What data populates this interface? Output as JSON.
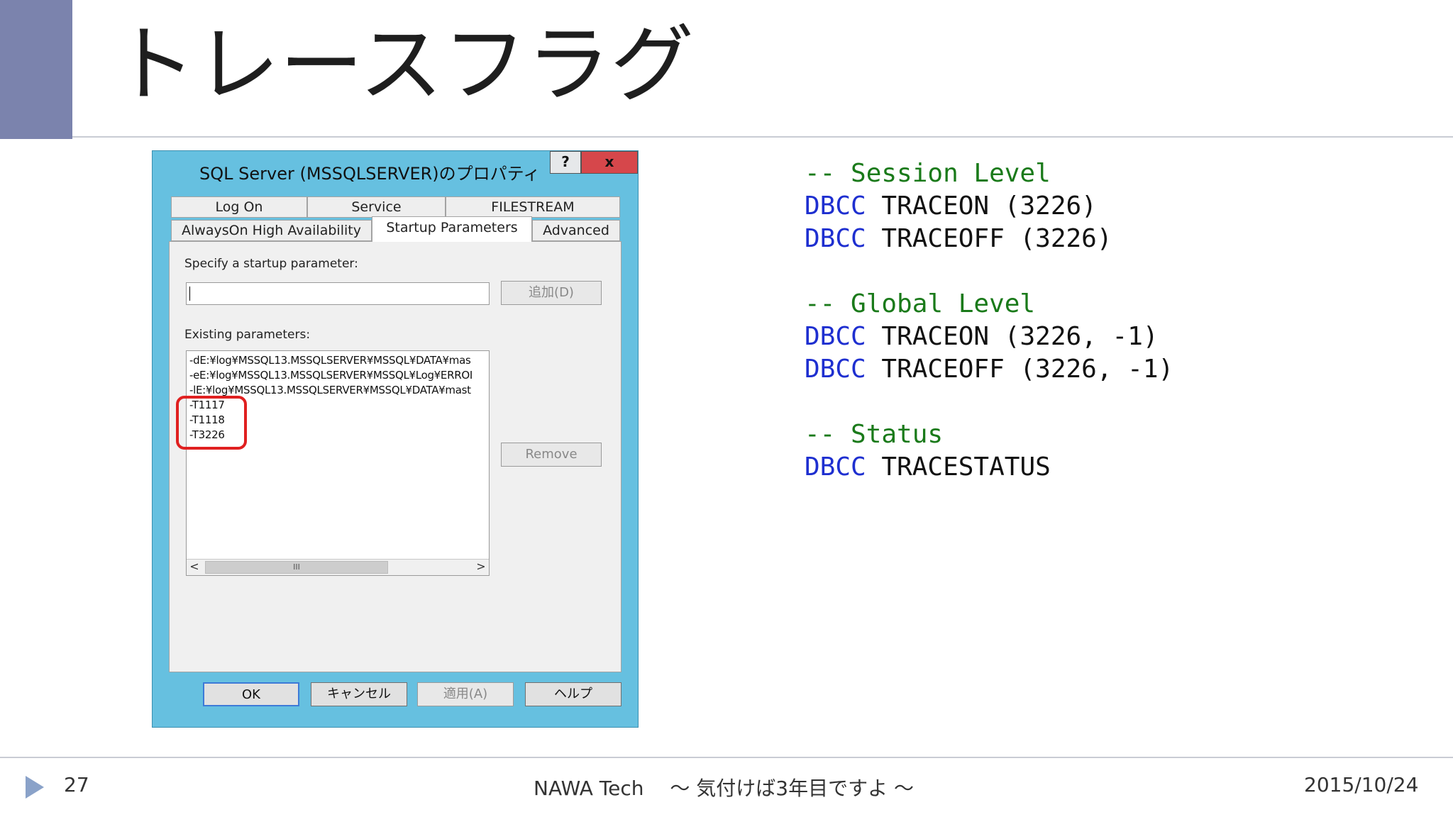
{
  "slide": {
    "title": "トレースフラグ",
    "page_number": "27",
    "footer_center": "NAWA Tech　 ～ 気付けば3年目ですよ ～",
    "date": "2015/10/24"
  },
  "dialog": {
    "title": "SQL Server (MSSQLSERVER)のプロパティ",
    "help_label": "?",
    "close_label": "x",
    "tabs_row1": [
      "Log On",
      "Service",
      "FILESTREAM"
    ],
    "tabs_row2": [
      "AlwaysOn High Availability",
      "Startup Parameters",
      "Advanced"
    ],
    "active_tab": "Startup Parameters",
    "specify_label": "Specify a startup parameter:",
    "input_value": "",
    "add_button": "追加(D)",
    "existing_label": "Existing parameters:",
    "parameters": [
      "-dE:¥log¥MSSQL13.MSSQLSERVER¥MSSQL¥DATA¥mas",
      "-eE:¥log¥MSSQL13.MSSQLSERVER¥MSSQL¥Log¥ERROI",
      "-lE:¥log¥MSSQL13.MSSQLSERVER¥MSSQL¥DATA¥mast",
      "-T1117",
      "-T1118",
      "-T3226"
    ],
    "scroll_left": "<",
    "scroll_right": ">",
    "scroll_thumb": "III",
    "remove_button": "Remove",
    "ok_button": "OK",
    "cancel_button": "キャンセル",
    "apply_button": "適用(A)",
    "help_button": "ヘルプ"
  },
  "code": {
    "session_comment": "-- Session Level",
    "session_on": {
      "kw": "DBCC",
      "cmd": "TRACEON",
      "args": "(3226)"
    },
    "session_off": {
      "kw": "DBCC",
      "cmd": "TRACEOFF",
      "args": "(3226)"
    },
    "global_comment": "-- Global Level",
    "global_on": {
      "kw": "DBCC",
      "cmd": "TRACEON",
      "args": "(3226, -1)"
    },
    "global_off": {
      "kw": "DBCC",
      "cmd": "TRACEOFF",
      "args": "(3226, -1)"
    },
    "status_comment": "-- Status",
    "status_cmd": {
      "kw": "DBCC",
      "cmd": "TRACESTATUS"
    }
  },
  "colors": {
    "accent_block": "#7b83ad",
    "dialog_frame": "#66c0e0",
    "close_button": "#d6474b",
    "highlight": "#e02020",
    "comment": "#1a7a1a",
    "keyword": "#1e2fd0"
  }
}
